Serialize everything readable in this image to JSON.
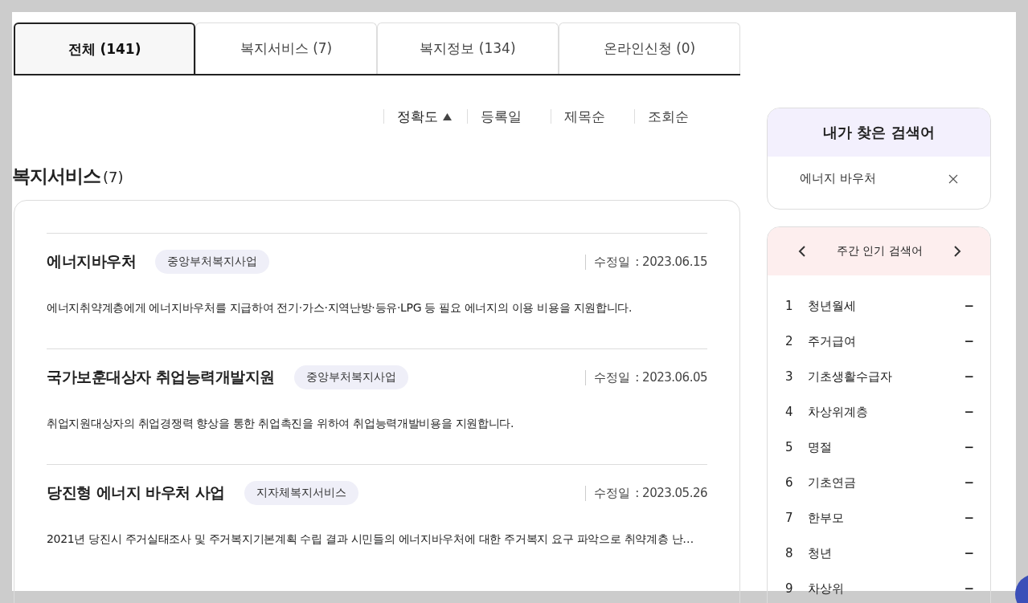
{
  "tabs": [
    {
      "label": "전체  (141)",
      "selected": true
    },
    {
      "label": "복지서비스 (7)",
      "selected": false
    },
    {
      "label": "복지정보 (134)",
      "selected": false
    },
    {
      "label": "온라인신청 (0)",
      "selected": false
    }
  ],
  "sort_options": [
    {
      "label": "정확도",
      "selected": true
    },
    {
      "label": "등록일",
      "selected": false
    },
    {
      "label": "제목순",
      "selected": false
    },
    {
      "label": "조회순",
      "selected": false
    }
  ],
  "section": {
    "title": "복지서비스",
    "count": "(7)"
  },
  "results": [
    {
      "title": "에너지바우처",
      "tag": "중앙부처복지사업",
      "date_label": "수정일",
      "date": ": 2023.06.15",
      "description": "에너지취약계층에게 에너지바우처를 지급하여 전기·가스·지역난방·등유·LPG 등 필요 에너지의 이용 비용을 지원합니다."
    },
    {
      "title": "국가보훈대상자 취업능력개발지원",
      "tag": "중앙부처복지사업",
      "date_label": "수정일",
      "date": ": 2023.06.05",
      "description": "취업지원대상자의 취업경쟁력 향상을 통한 취업촉진을 위하여 취업능력개발비용을 지원합니다."
    },
    {
      "title": "당진형 에너지 바우처 사업",
      "tag": "지자체복지서비스",
      "date_label": "수정일",
      "date": ": 2023.05.26",
      "description": "2021년 당진시 주거실태조사 및 주거복지기본계획 수립 결과 시민들의 에너지바우처에 대한 주거복지 요구 파악으로 취약계층 난…"
    }
  ],
  "my_searches": {
    "title": "내가 찾은 검색어",
    "items": [
      "에너지 바우처"
    ]
  },
  "popular": {
    "title": "주간 인기 검색어",
    "items": [
      {
        "rank": "1",
        "term": "청년월세",
        "change": "−"
      },
      {
        "rank": "2",
        "term": "주거급여",
        "change": "−"
      },
      {
        "rank": "3",
        "term": "기초생활수급자",
        "change": "−"
      },
      {
        "rank": "4",
        "term": "차상위계층",
        "change": "−"
      },
      {
        "rank": "5",
        "term": "명절",
        "change": "−"
      },
      {
        "rank": "6",
        "term": "기초연금",
        "change": "−"
      },
      {
        "rank": "7",
        "term": "한부모",
        "change": "−"
      },
      {
        "rank": "8",
        "term": "청년",
        "change": "−"
      },
      {
        "rank": "9",
        "term": "차상위",
        "change": "−"
      }
    ]
  }
}
